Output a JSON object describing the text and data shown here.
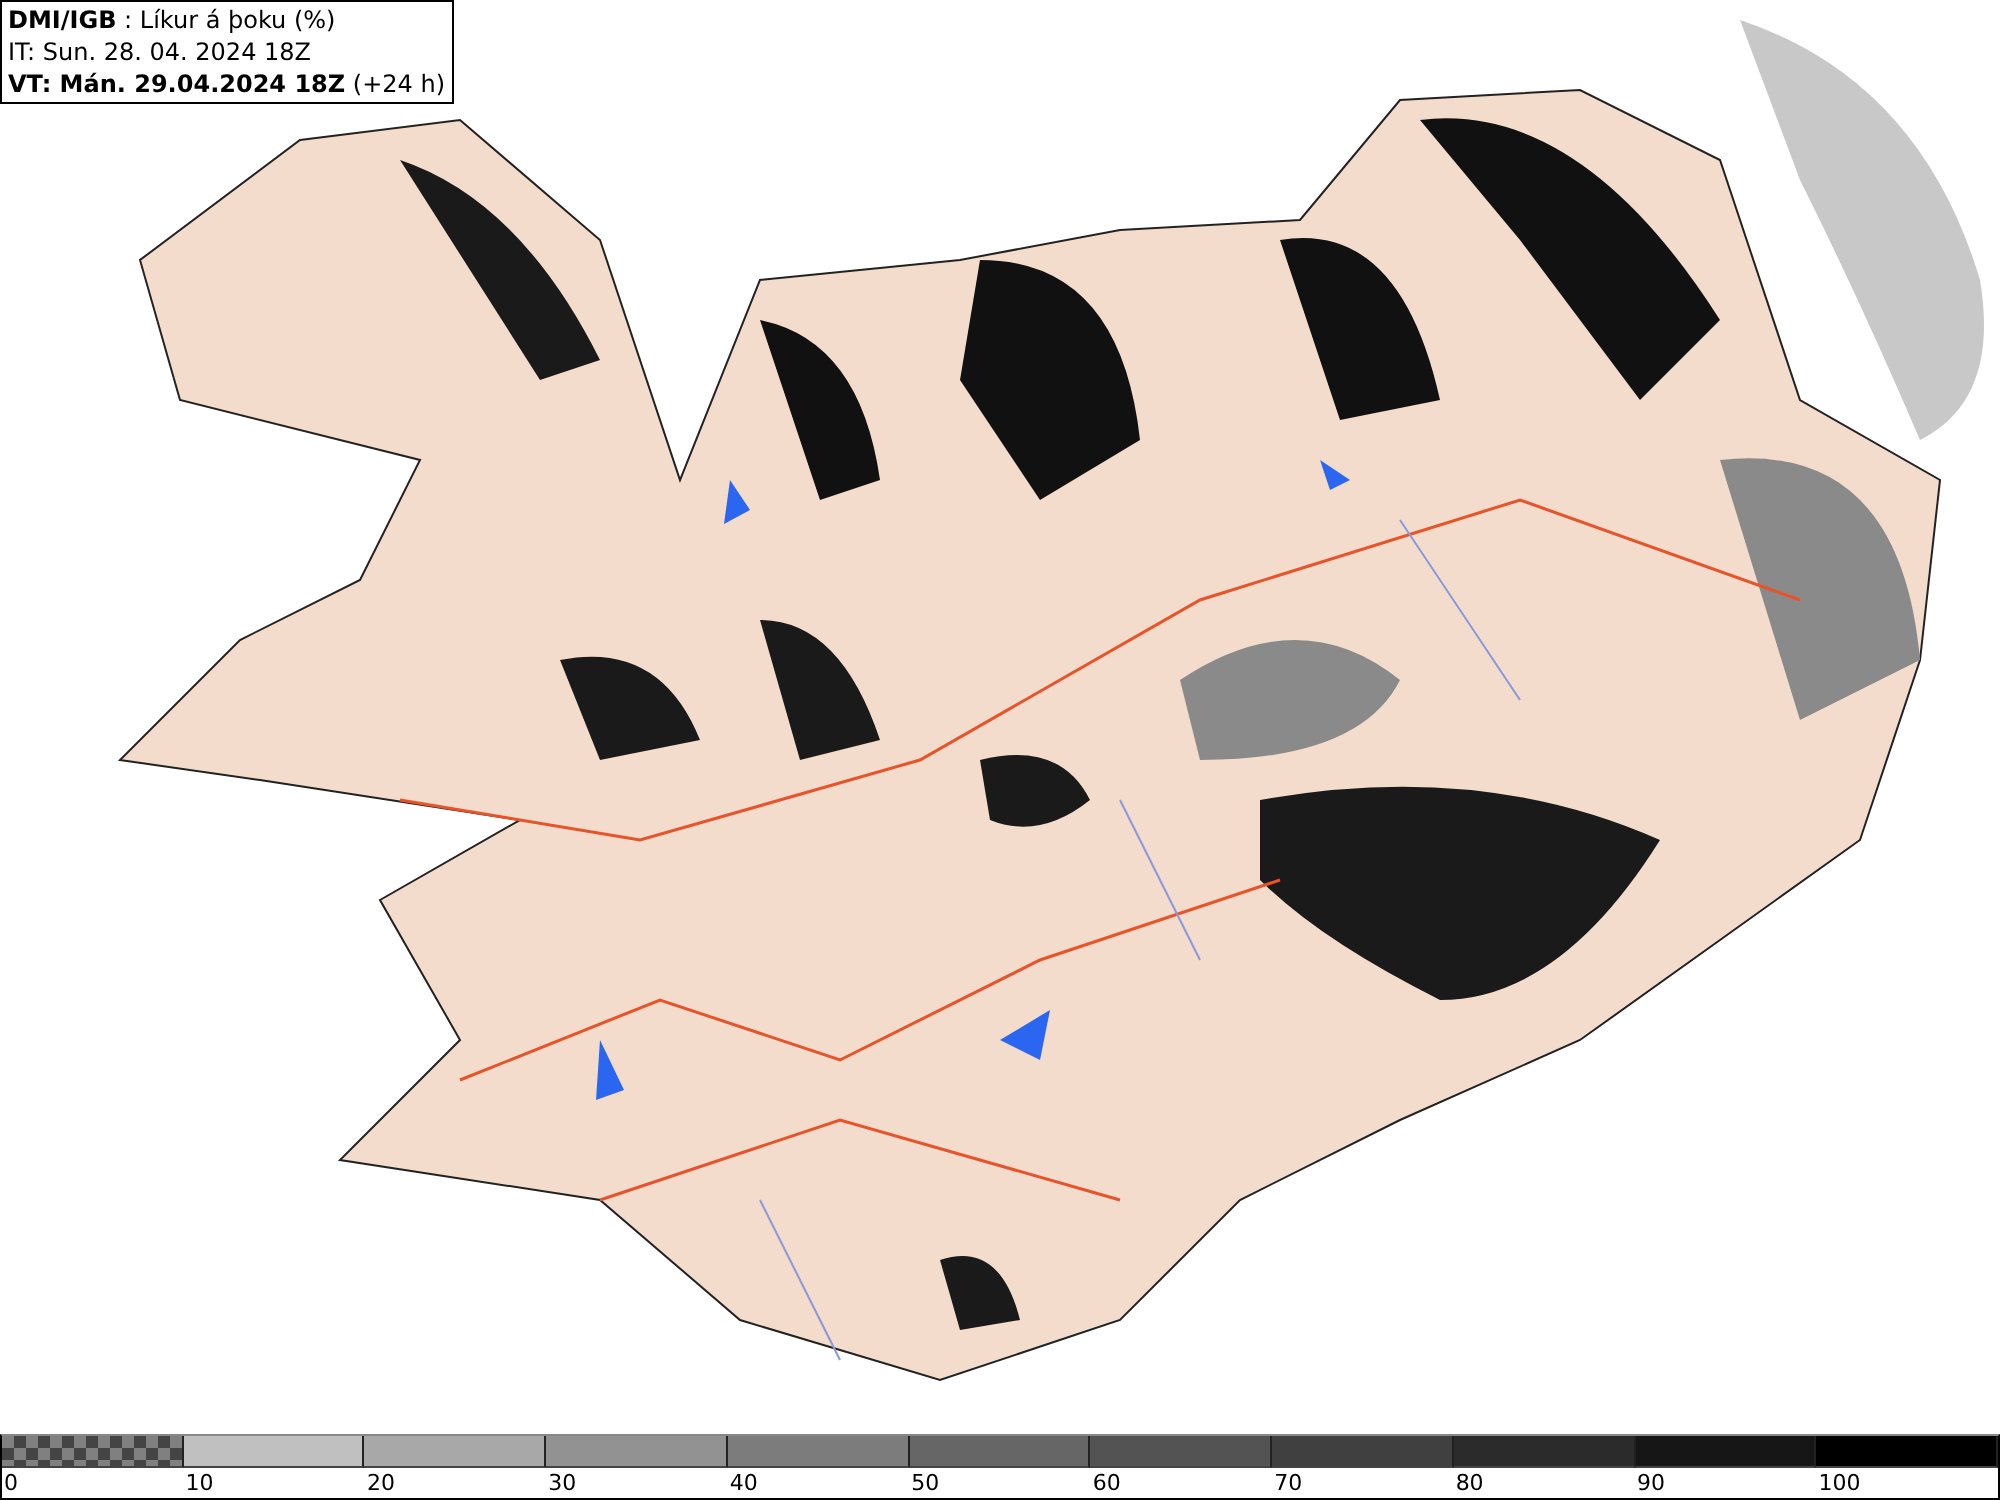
{
  "header": {
    "lines": [
      "**DMI/IGB** : Líkur á þoku (%)",
      "IT: Sun. 28. 04. 2024 18Z",
      "**VT: Mán. 29.04.2024 18Z** (+24 h)"
    ]
  },
  "legend": {
    "segments": [
      {
        "kind": "checkered",
        "color": "#808080",
        "label": "0"
      },
      {
        "kind": "solid",
        "color": "#c0c0c0",
        "label": "10"
      },
      {
        "kind": "solid",
        "color": "#a8a8a8",
        "label": "20"
      },
      {
        "kind": "solid",
        "color": "#929292",
        "label": "30"
      },
      {
        "kind": "solid",
        "color": "#7c7c7c",
        "label": "40"
      },
      {
        "kind": "solid",
        "color": "#666666",
        "label": "50"
      },
      {
        "kind": "solid",
        "color": "#535353",
        "label": "60"
      },
      {
        "kind": "solid",
        "color": "#404040",
        "label": "70"
      },
      {
        "kind": "solid",
        "color": "#2b2b2b",
        "label": "80"
      },
      {
        "kind": "solid",
        "color": "#161616",
        "label": "90"
      },
      {
        "kind": "solid",
        "color": "#000000",
        "label": "100"
      }
    ]
  }
}
